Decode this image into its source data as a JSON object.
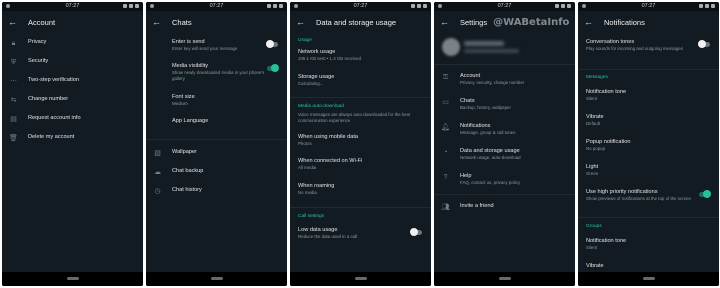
{
  "status_time": "07:27",
  "watermark": "@WABetaInfo",
  "panel1": {
    "title": "Account",
    "items": [
      {
        "label": "Privacy",
        "icon": "lock-icon"
      },
      {
        "label": "Security",
        "icon": "shield-icon"
      },
      {
        "label": "Two-step verification",
        "icon": "dots-icon"
      },
      {
        "label": "Change number",
        "icon": "phone-swap-icon"
      },
      {
        "label": "Request account info",
        "icon": "document-icon"
      },
      {
        "label": "Delete my account",
        "icon": "trash-icon"
      }
    ]
  },
  "panel2": {
    "title": "Chats",
    "items": [
      {
        "label": "Enter is send",
        "sub": "Enter key will send your message"
      },
      {
        "label": "Media visibility",
        "sub": "Show newly downloaded media in your phone's gallery"
      },
      {
        "label": "Font size",
        "sub": "Medium"
      },
      {
        "label": "App Language",
        "sub": ""
      },
      {
        "label": "Wallpaper",
        "sub": ""
      },
      {
        "label": "Chat backup",
        "sub": ""
      },
      {
        "label": "Chat history",
        "sub": ""
      }
    ]
  },
  "panel3": {
    "title": "Data and storage usage",
    "section_usage": "Usage",
    "network_label": "Network usage",
    "network_sub": "105.1 KB sent • 1.3 GB received",
    "storage_label": "Storage usage",
    "storage_sub": "Calculating...",
    "section_media": "Media auto-download",
    "media_sub": "Voice messages are always auto-downloaded for the best communication experience",
    "mobile_label": "When using mobile data",
    "mobile_sub": "Photos",
    "wifi_label": "When connected on Wi-Fi",
    "wifi_sub": "All media",
    "roaming_label": "When roaming",
    "roaming_sub": "No media",
    "section_call": "Call settings",
    "lowdata_label": "Low data usage",
    "lowdata_sub": "Reduce the data used in a call"
  },
  "panel4": {
    "title": "Settings",
    "items": [
      {
        "label": "Account",
        "sub": "Privacy, security, change number"
      },
      {
        "label": "Chats",
        "sub": "Backup, history, wallpaper"
      },
      {
        "label": "Notifications",
        "sub": "Message, group & call tones"
      },
      {
        "label": "Data and storage usage",
        "sub": "Network usage, auto-download"
      },
      {
        "label": "Help",
        "sub": "FAQ, contact us, privacy policy"
      },
      {
        "label": "Invite a friend",
        "sub": ""
      }
    ]
  },
  "panel5": {
    "title": "Notifications",
    "conv_label": "Conversation tones",
    "conv_sub": "Play sounds for incoming and outgoing messages",
    "section_messages": "Messages",
    "tone_label": "Notification tone",
    "tone_sub": "Silent",
    "vibrate_label": "Vibrate",
    "vibrate_sub": "Default",
    "popup_label": "Popup notification",
    "popup_sub": "No popup",
    "light_label": "Light",
    "light_sub": "Green",
    "hp_label": "Use high priority notifications",
    "hp_sub": "Show previews of notifications at the top of the screen",
    "section_groups": "Groups",
    "gtone_label": "Notification tone",
    "gtone_sub": "Silent",
    "gvibrate_label": "Vibrate"
  }
}
